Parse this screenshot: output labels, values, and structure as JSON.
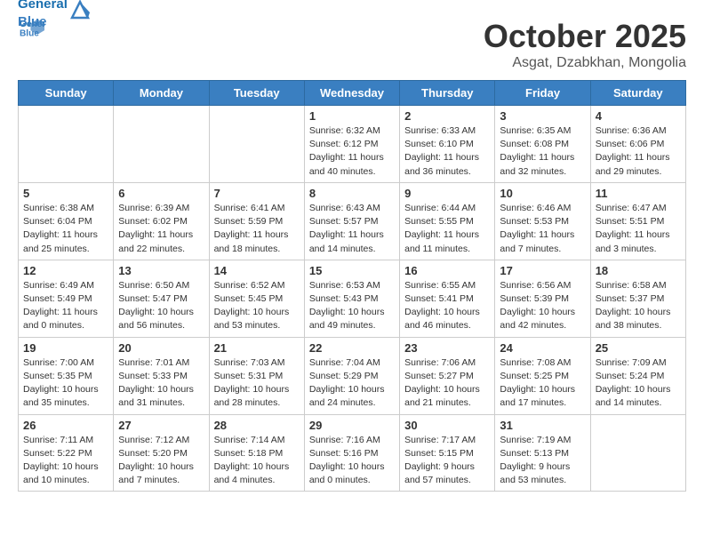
{
  "header": {
    "logo_line1": "General",
    "logo_line2": "Blue",
    "month": "October 2025",
    "location": "Asgat, Dzabkhan, Mongolia"
  },
  "weekdays": [
    "Sunday",
    "Monday",
    "Tuesday",
    "Wednesday",
    "Thursday",
    "Friday",
    "Saturday"
  ],
  "weeks": [
    [
      {
        "day": "",
        "info": ""
      },
      {
        "day": "",
        "info": ""
      },
      {
        "day": "",
        "info": ""
      },
      {
        "day": "1",
        "info": "Sunrise: 6:32 AM\nSunset: 6:12 PM\nDaylight: 11 hours\nand 40 minutes."
      },
      {
        "day": "2",
        "info": "Sunrise: 6:33 AM\nSunset: 6:10 PM\nDaylight: 11 hours\nand 36 minutes."
      },
      {
        "day": "3",
        "info": "Sunrise: 6:35 AM\nSunset: 6:08 PM\nDaylight: 11 hours\nand 32 minutes."
      },
      {
        "day": "4",
        "info": "Sunrise: 6:36 AM\nSunset: 6:06 PM\nDaylight: 11 hours\nand 29 minutes."
      }
    ],
    [
      {
        "day": "5",
        "info": "Sunrise: 6:38 AM\nSunset: 6:04 PM\nDaylight: 11 hours\nand 25 minutes."
      },
      {
        "day": "6",
        "info": "Sunrise: 6:39 AM\nSunset: 6:02 PM\nDaylight: 11 hours\nand 22 minutes."
      },
      {
        "day": "7",
        "info": "Sunrise: 6:41 AM\nSunset: 5:59 PM\nDaylight: 11 hours\nand 18 minutes."
      },
      {
        "day": "8",
        "info": "Sunrise: 6:43 AM\nSunset: 5:57 PM\nDaylight: 11 hours\nand 14 minutes."
      },
      {
        "day": "9",
        "info": "Sunrise: 6:44 AM\nSunset: 5:55 PM\nDaylight: 11 hours\nand 11 minutes."
      },
      {
        "day": "10",
        "info": "Sunrise: 6:46 AM\nSunset: 5:53 PM\nDaylight: 11 hours\nand 7 minutes."
      },
      {
        "day": "11",
        "info": "Sunrise: 6:47 AM\nSunset: 5:51 PM\nDaylight: 11 hours\nand 3 minutes."
      }
    ],
    [
      {
        "day": "12",
        "info": "Sunrise: 6:49 AM\nSunset: 5:49 PM\nDaylight: 11 hours\nand 0 minutes."
      },
      {
        "day": "13",
        "info": "Sunrise: 6:50 AM\nSunset: 5:47 PM\nDaylight: 10 hours\nand 56 minutes."
      },
      {
        "day": "14",
        "info": "Sunrise: 6:52 AM\nSunset: 5:45 PM\nDaylight: 10 hours\nand 53 minutes."
      },
      {
        "day": "15",
        "info": "Sunrise: 6:53 AM\nSunset: 5:43 PM\nDaylight: 10 hours\nand 49 minutes."
      },
      {
        "day": "16",
        "info": "Sunrise: 6:55 AM\nSunset: 5:41 PM\nDaylight: 10 hours\nand 46 minutes."
      },
      {
        "day": "17",
        "info": "Sunrise: 6:56 AM\nSunset: 5:39 PM\nDaylight: 10 hours\nand 42 minutes."
      },
      {
        "day": "18",
        "info": "Sunrise: 6:58 AM\nSunset: 5:37 PM\nDaylight: 10 hours\nand 38 minutes."
      }
    ],
    [
      {
        "day": "19",
        "info": "Sunrise: 7:00 AM\nSunset: 5:35 PM\nDaylight: 10 hours\nand 35 minutes."
      },
      {
        "day": "20",
        "info": "Sunrise: 7:01 AM\nSunset: 5:33 PM\nDaylight: 10 hours\nand 31 minutes."
      },
      {
        "day": "21",
        "info": "Sunrise: 7:03 AM\nSunset: 5:31 PM\nDaylight: 10 hours\nand 28 minutes."
      },
      {
        "day": "22",
        "info": "Sunrise: 7:04 AM\nSunset: 5:29 PM\nDaylight: 10 hours\nand 24 minutes."
      },
      {
        "day": "23",
        "info": "Sunrise: 7:06 AM\nSunset: 5:27 PM\nDaylight: 10 hours\nand 21 minutes."
      },
      {
        "day": "24",
        "info": "Sunrise: 7:08 AM\nSunset: 5:25 PM\nDaylight: 10 hours\nand 17 minutes."
      },
      {
        "day": "25",
        "info": "Sunrise: 7:09 AM\nSunset: 5:24 PM\nDaylight: 10 hours\nand 14 minutes."
      }
    ],
    [
      {
        "day": "26",
        "info": "Sunrise: 7:11 AM\nSunset: 5:22 PM\nDaylight: 10 hours\nand 10 minutes."
      },
      {
        "day": "27",
        "info": "Sunrise: 7:12 AM\nSunset: 5:20 PM\nDaylight: 10 hours\nand 7 minutes."
      },
      {
        "day": "28",
        "info": "Sunrise: 7:14 AM\nSunset: 5:18 PM\nDaylight: 10 hours\nand 4 minutes."
      },
      {
        "day": "29",
        "info": "Sunrise: 7:16 AM\nSunset: 5:16 PM\nDaylight: 10 hours\nand 0 minutes."
      },
      {
        "day": "30",
        "info": "Sunrise: 7:17 AM\nSunset: 5:15 PM\nDaylight: 9 hours\nand 57 minutes."
      },
      {
        "day": "31",
        "info": "Sunrise: 7:19 AM\nSunset: 5:13 PM\nDaylight: 9 hours\nand 53 minutes."
      },
      {
        "day": "",
        "info": ""
      }
    ]
  ]
}
